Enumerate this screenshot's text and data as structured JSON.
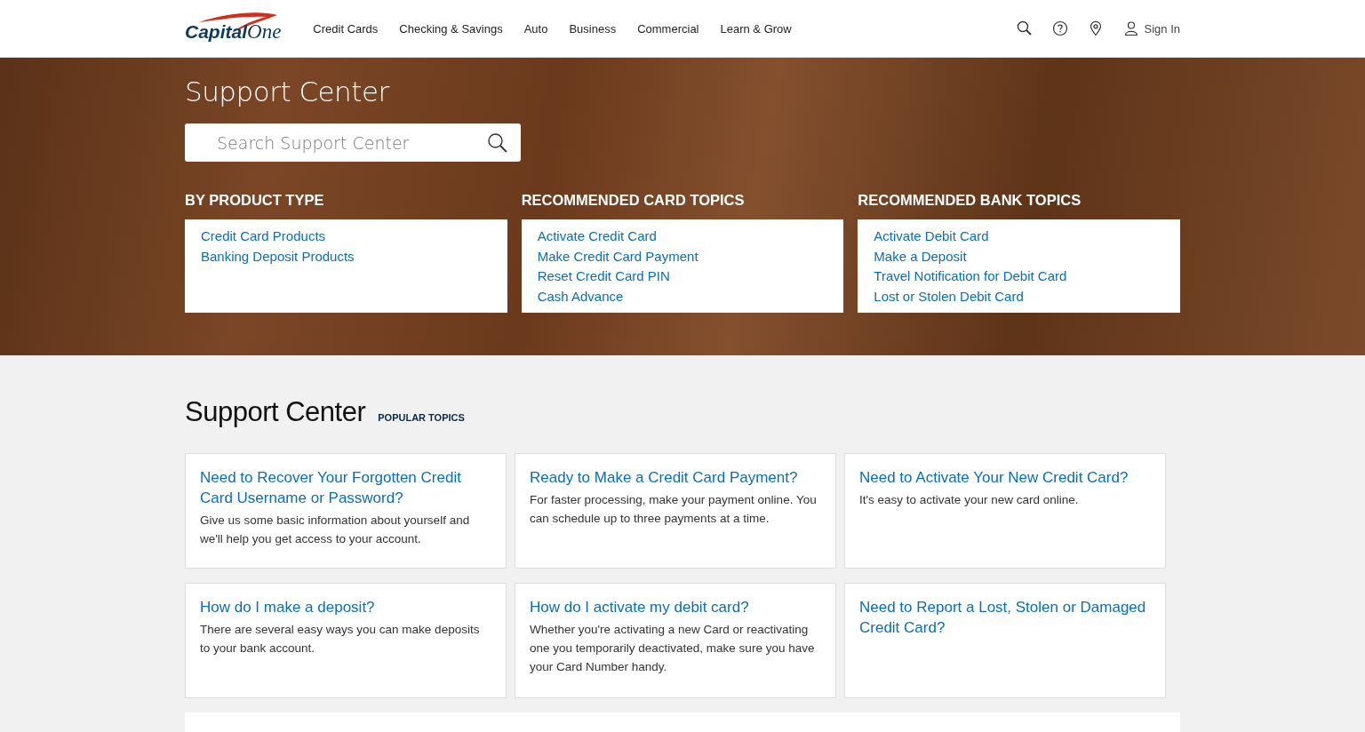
{
  "header": {
    "logo": {
      "part_1": "Capital",
      "part_2": "One"
    },
    "nav": [
      "Credit Cards",
      "Checking & Savings",
      "Auto",
      "Business",
      "Commercial",
      "Learn & Grow"
    ],
    "sign_in": "Sign In"
  },
  "hero": {
    "title": "Support Center",
    "search": {
      "placeholder": "Search Support Center"
    },
    "columns": [
      {
        "heading": "BY PRODUCT TYPE",
        "links": [
          "Credit Card Products",
          "Banking Deposit Products"
        ]
      },
      {
        "heading": "RECOMMENDED CARD TOPICS",
        "links": [
          "Activate Credit Card",
          "Make Credit Card Payment",
          "Reset Credit Card PIN",
          "Cash Advance"
        ]
      },
      {
        "heading": "RECOMMENDED BANK TOPICS",
        "links": [
          "Activate Debit Card",
          "Make a Deposit",
          "Travel Notification for Debit Card",
          "Lost or Stolen Debit Card"
        ]
      }
    ]
  },
  "popular": {
    "title": "Support Center",
    "subtitle": "POPULAR TOPICS",
    "cards": [
      {
        "title": "Need to Recover Your Forgotten Credit Card Username or Password?",
        "text": "Give us some basic information about yourself and we'll help you get access to your account."
      },
      {
        "title": "Ready to Make a Credit Card Payment?",
        "text": "For faster processing, make your payment online. You can schedule up to three payments at a time."
      },
      {
        "title": "Need to Activate Your New Credit Card?",
        "text": "It's easy to activate your new card online."
      },
      {
        "title": "How do I make a deposit?",
        "text": "There are several easy ways you can make deposits to your bank account."
      },
      {
        "title": "How do I activate my debit card?",
        "text": "Whether you're activating a new Card or reactivating one you temporarily deactivated, make sure you have your Card Number handy."
      },
      {
        "title": "Need to Report a Lost, Stolen or Damaged Credit Card?"
      }
    ]
  }
}
